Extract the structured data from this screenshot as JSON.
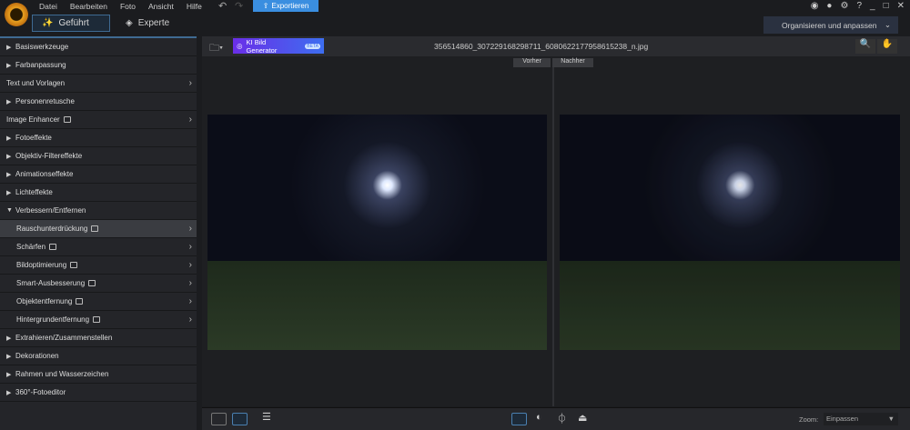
{
  "menu": [
    "Datei",
    "Bearbeiten",
    "Foto",
    "Ansicht",
    "Hilfe"
  ],
  "export_label": "Exportieren",
  "modes": {
    "guided": "Geführt",
    "expert": "Experte"
  },
  "organize_label": "Organisieren und anpassen",
  "ai_button": {
    "label": "KI Bild Generator",
    "badge": "BETA"
  },
  "filename": "356514860_307229168298711_6080622177958615238_n.jpg",
  "compare": {
    "before": "Vorher",
    "after": "Nachher"
  },
  "sidebar": [
    {
      "label": "Basiswerkzeuge",
      "type": "group"
    },
    {
      "label": "Farbanpassung",
      "type": "group"
    },
    {
      "label": "Text und Vorlagen",
      "type": "link"
    },
    {
      "label": "Personenretusche",
      "type": "group"
    },
    {
      "label": "Image Enhancer",
      "type": "link",
      "icon": true
    },
    {
      "label": "Fotoeffekte",
      "type": "group"
    },
    {
      "label": "Objektiv-Filtereffekte",
      "type": "group"
    },
    {
      "label": "Animationseffekte",
      "type": "group"
    },
    {
      "label": "Lichteffekte",
      "type": "group"
    },
    {
      "label": "Verbessern/Entfernen",
      "type": "open"
    },
    {
      "label": "Rauschunterdrückung",
      "type": "sub",
      "icon": true,
      "selected": true
    },
    {
      "label": "Schärfen",
      "type": "sub",
      "icon": true
    },
    {
      "label": "Bildoptimierung",
      "type": "sub",
      "icon": true
    },
    {
      "label": "Smart-Ausbesserung",
      "type": "sub",
      "icon": true
    },
    {
      "label": "Objektentfernung",
      "type": "sub",
      "icon": true
    },
    {
      "label": "Hintergrundentfernung",
      "type": "sub",
      "icon": true
    },
    {
      "label": "Extrahieren/Zusammenstellen",
      "type": "group"
    },
    {
      "label": "Dekorationen",
      "type": "group"
    },
    {
      "label": "Rahmen und Wasserzeichen",
      "type": "group"
    },
    {
      "label": "360°-Fotoeditor",
      "type": "group"
    }
  ],
  "zoom": {
    "label": "Zoom:",
    "value": "Einpassen"
  }
}
